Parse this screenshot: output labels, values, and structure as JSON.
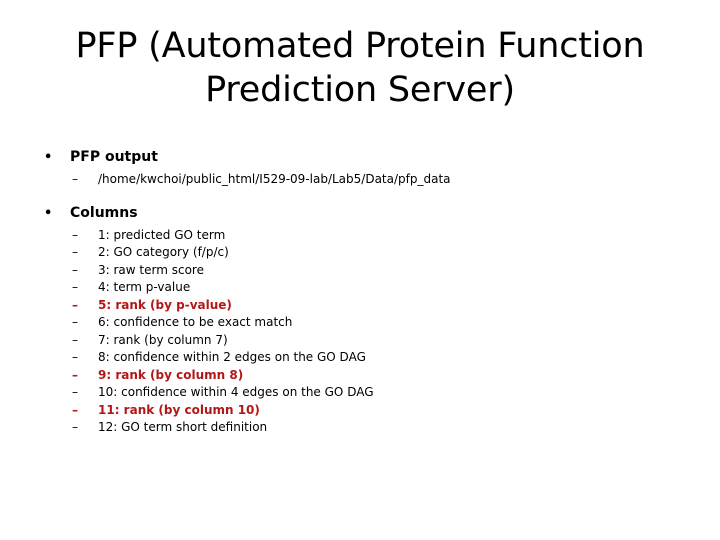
{
  "slide": {
    "title_lines": [
      "PFP (Automated Protein Function",
      "Prediction Server)"
    ],
    "bullet_marker": "•",
    "dash_marker": "–",
    "highlight_color": "#B41717",
    "text_color": "#000000",
    "background_color": "#FFFFFF",
    "sections": [
      {
        "heading": "PFP output",
        "items": [
          {
            "text": "/home/kwchoi/public_html/I529-09-lab/Lab5/Data/pfp_data",
            "highlight": false
          }
        ]
      },
      {
        "heading": "Columns",
        "items": [
          {
            "text": "1: predicted GO term",
            "highlight": false
          },
          {
            "text": "2: GO category (f/p/c)",
            "highlight": false
          },
          {
            "text": "3: raw term score",
            "highlight": false
          },
          {
            "text": "4: term p-value",
            "highlight": false
          },
          {
            "text": "5: rank (by p-value)",
            "highlight": true
          },
          {
            "text": "6: confidence to be exact match",
            "highlight": false
          },
          {
            "text": "7: rank (by column 7)",
            "highlight": false
          },
          {
            "text": "8: confidence within 2 edges on the GO DAG",
            "highlight": false
          },
          {
            "text": "9: rank (by column 8)",
            "highlight": true
          },
          {
            "text": "10: confidence within 4 edges on the GO DAG",
            "highlight": false
          },
          {
            "text": "11: rank (by column 10)",
            "highlight": true
          },
          {
            "text": "12: GO term short definition",
            "highlight": false
          }
        ]
      }
    ]
  }
}
